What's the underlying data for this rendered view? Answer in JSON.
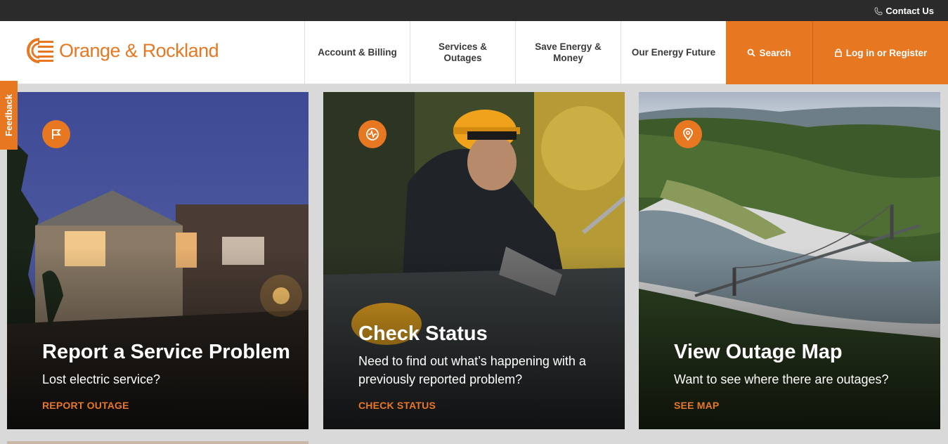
{
  "topbar": {
    "contact_label": "Contact Us"
  },
  "header": {
    "logo_text": "Orange & Rockland"
  },
  "nav": {
    "items": [
      {
        "label": "Account & Billing"
      },
      {
        "label": "Services & Outages"
      },
      {
        "label": "Save Energy & Money"
      },
      {
        "label": "Our Energy Future"
      }
    ],
    "search_label": "Search",
    "login_label": "Log in or Register"
  },
  "feedback_label": "Feedback",
  "cards": [
    {
      "title": "Report a Service Problem",
      "desc": "Lost electric service?",
      "link": "REPORT OUTAGE",
      "icon": "flag-icon"
    },
    {
      "title": "Check Status",
      "desc": "Need to find out what’s happening with a previously reported problem?",
      "link": "CHECK STATUS",
      "icon": "status-pulse-icon"
    },
    {
      "title": "View Outage Map",
      "desc": "Want to see where there are outages?",
      "link": "SEE MAP",
      "icon": "map-pin-icon"
    }
  ],
  "colors": {
    "accent": "#e87722",
    "topbar": "#2b2b2b",
    "page_bg": "#d9d9d9"
  }
}
